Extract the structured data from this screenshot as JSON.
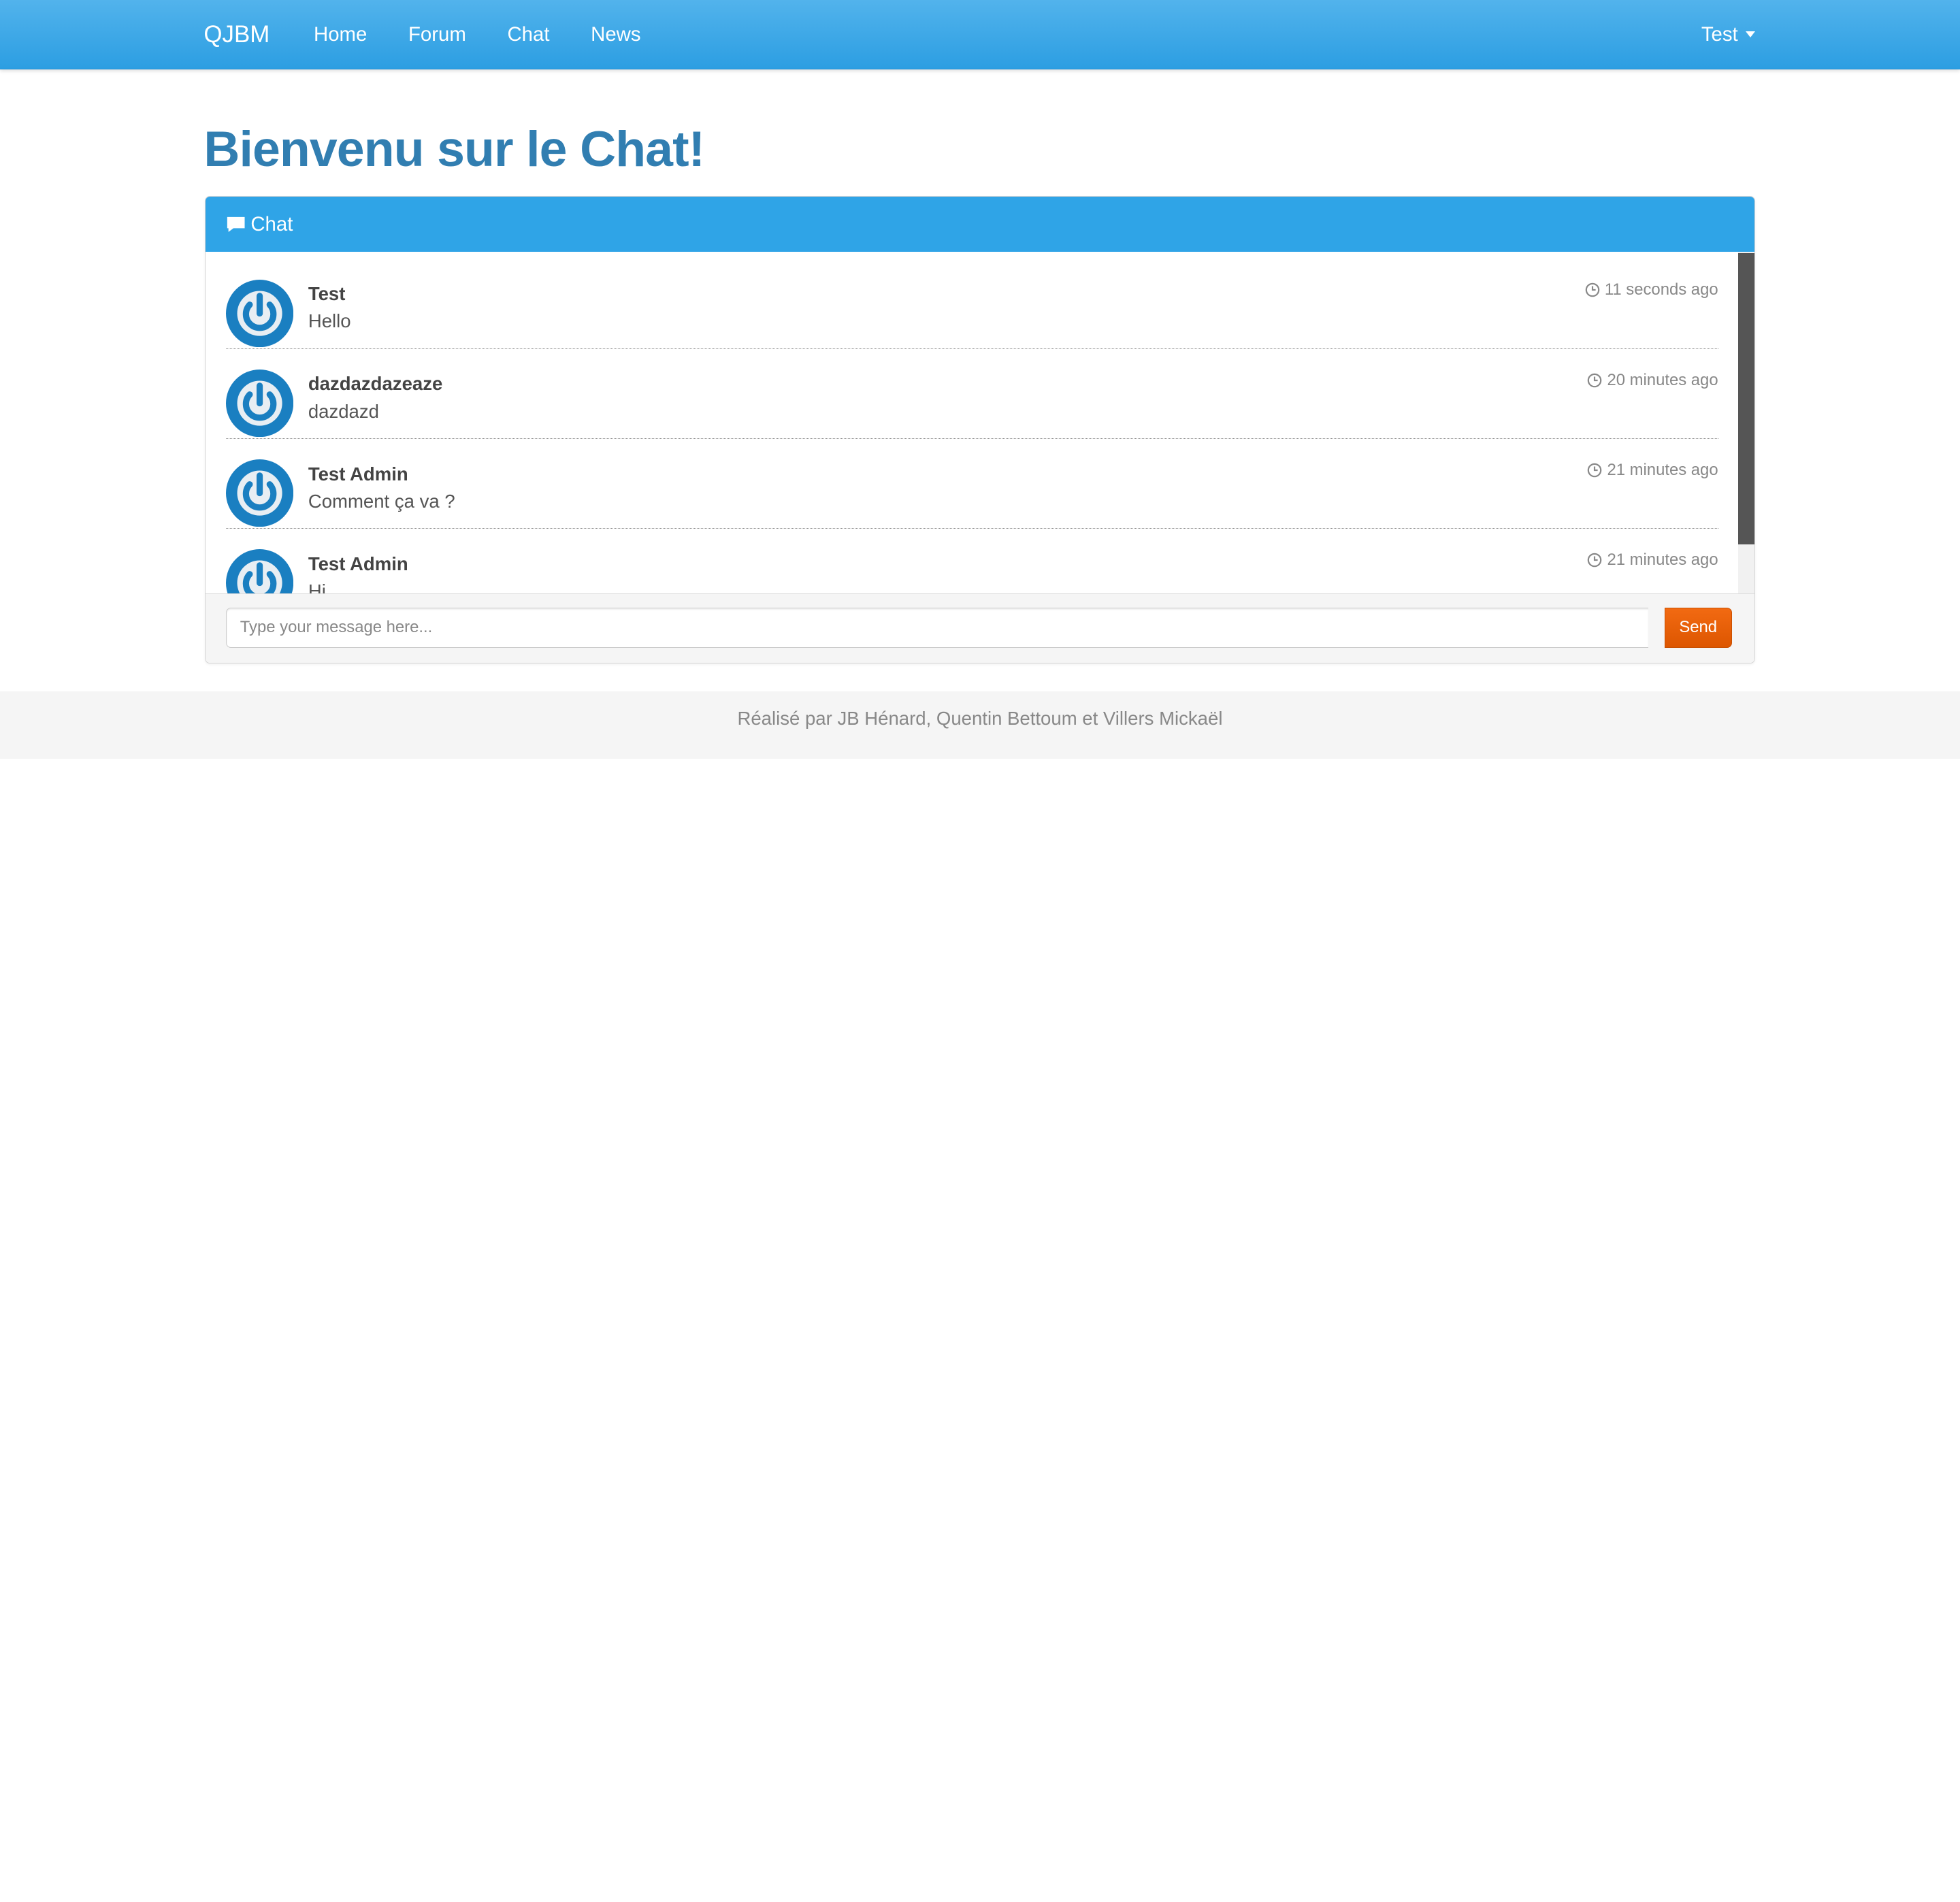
{
  "navbar": {
    "brand": "QJBM",
    "links": [
      "Home",
      "Forum",
      "Chat",
      "News"
    ],
    "user": "Test"
  },
  "page_title": "Bienvenu sur le Chat!",
  "chat_panel": {
    "heading": "Chat",
    "messages": [
      {
        "user": "Test",
        "text": "Hello",
        "time": "11 seconds ago"
      },
      {
        "user": "dazdazdazeaze",
        "text": "dazdazd",
        "time": "20 minutes ago"
      },
      {
        "user": "Test Admin",
        "text": "Comment ça va ?",
        "time": "21 minutes ago"
      },
      {
        "user": "Test Admin",
        "text": "Hi",
        "time": "21 minutes ago"
      }
    ],
    "input_placeholder": "Type your message here...",
    "send_label": "Send"
  },
  "colors": {
    "navbar": "#2fa4e7",
    "title": "#317eb1",
    "send_button": "#dd5600"
  },
  "icons": [
    "comment-icon",
    "clock-icon",
    "power-avatar-icon",
    "caret-down-icon"
  ],
  "footer": {
    "text": "Réalisé par JB Hénard, Quentin Bettoum et Villers Mickaël"
  }
}
